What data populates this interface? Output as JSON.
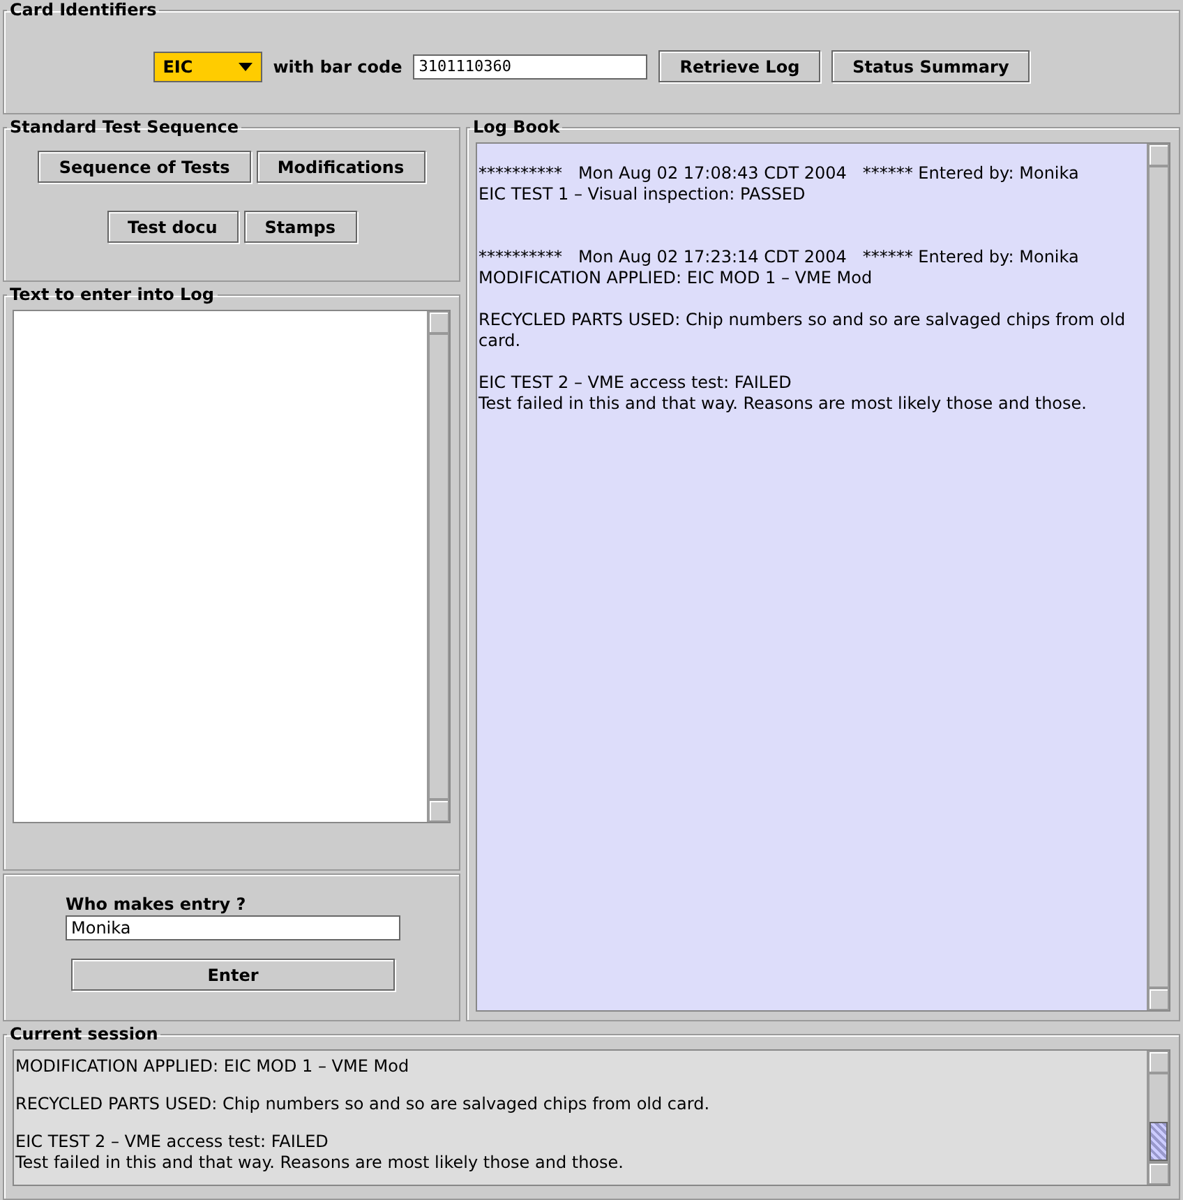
{
  "card_identifiers": {
    "title": "Card Identifiers",
    "card_type": "EIC",
    "bar_code_label": "with bar code",
    "bar_code": "3101110360",
    "buttons": [
      "Retrieve Log",
      "Status Summary"
    ]
  },
  "standard_test_sequence": {
    "title": "Standard Test Sequence",
    "buttons": [
      "Sequence of Tests",
      "Modifications",
      "Test docu",
      "Stamps"
    ]
  },
  "text_to_enter": {
    "title": "Text to enter into Log"
  },
  "entry": {
    "label": "Who makes entry ?",
    "name": "Monika",
    "button": "Enter"
  },
  "log_book": {
    "title": "Log Book",
    "paragraphs": [
      {
        "kind": "entry",
        "lines": [
          "**********   Mon Aug 02 17:08:43 CDT 2004   ****** Entered by: Monika",
          "EIC TEST 1 – Visual inspection: PASSED"
        ]
      },
      {
        "kind": "entry",
        "lines": [
          "**********   Mon Aug 02 17:23:14 CDT 2004   ****** Entered by: Monika",
          "MODIFICATION APPLIED: EIC MOD 1 – VME Mod"
        ]
      },
      {
        "kind": "note",
        "lines": [
          "RECYCLED PARTS USED: Chip numbers so and so are salvaged chips from old card."
        ]
      },
      {
        "kind": "note",
        "lines": [
          "EIC TEST 2 – VME access test: FAILED",
          "Test failed in this and that way. Reasons are most likely those and those."
        ]
      }
    ]
  },
  "current_session": {
    "title": "Current session",
    "paragraphs": [
      {
        "kind": "note",
        "lines": [
          "MODIFICATION APPLIED: EIC MOD 1 – VME Mod"
        ]
      },
      {
        "kind": "note",
        "lines": [
          "RECYCLED PARTS USED: Chip numbers so and so are salvaged chips from old card."
        ]
      },
      {
        "kind": "note",
        "lines": [
          "EIC TEST 2 – VME access test: FAILED",
          "Test failed in this and that way. Reasons are most likely those and those."
        ]
      }
    ]
  }
}
